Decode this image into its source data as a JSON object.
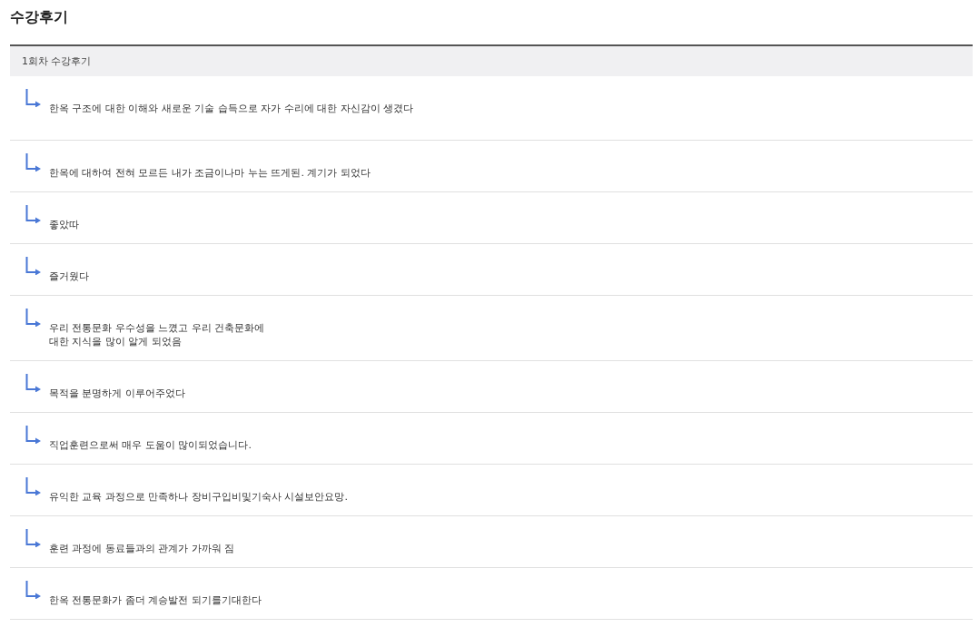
{
  "title": "수강후기",
  "section": {
    "header": "1회차 수강후기",
    "reviews": [
      "한옥 구조에 대한 이해와 새로운 기술 습득으로 자가 수리에 대한 자신감이 생겼다",
      "한옥에 대하여 전혀 모르든 내가 조금이나마 누는 뜨게된. 계기가 되었다",
      "좋았따",
      "즐거웠다",
      "우리 전통문화 우수성을 느꼈고 우리 건축문화에\n대한 지식을 많이 알게 되었음",
      "목적을 분명하게 이루어주었다",
      "직업훈련으로써 매우 도움이 많이되었습니다.",
      "유익한 교육 과정으로 만족하나 장비구입비및기숙사 시설보안요망.",
      "훈련 과정에 동료들과의 관계가 가까워 짐",
      "한옥 전통문화가 좀더 계승발전 되기를기대한다"
    ]
  }
}
